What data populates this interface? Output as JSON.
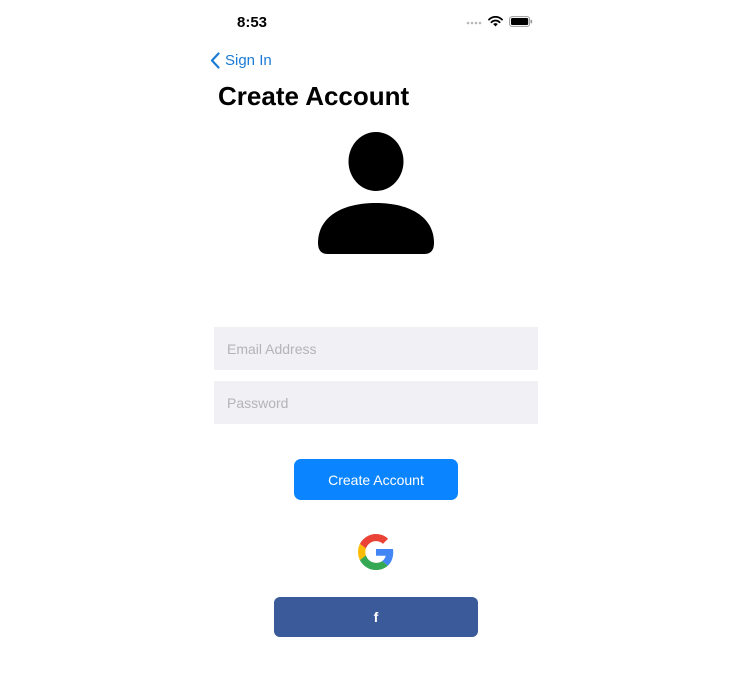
{
  "status_bar": {
    "time": "8:53",
    "icons": [
      "cellular-dots-icon",
      "wifi-icon",
      "battery-icon"
    ]
  },
  "nav": {
    "back_label": "Sign In",
    "back_icon": "chevron-left-icon",
    "title": "Create Account"
  },
  "avatar": {
    "icon": "person-icon",
    "color": "#000000"
  },
  "form": {
    "email_placeholder": "Email Address",
    "email_value": "",
    "password_placeholder": "Password",
    "password_value": ""
  },
  "buttons": {
    "create_account_label": "Create Account",
    "google_icon": "google-logo-icon",
    "facebook_label": "f"
  },
  "colors": {
    "accent": "#0a84ff",
    "link": "#1a7bd6",
    "facebook": "#3b5a9a",
    "field_background": "#f1f1f5"
  }
}
